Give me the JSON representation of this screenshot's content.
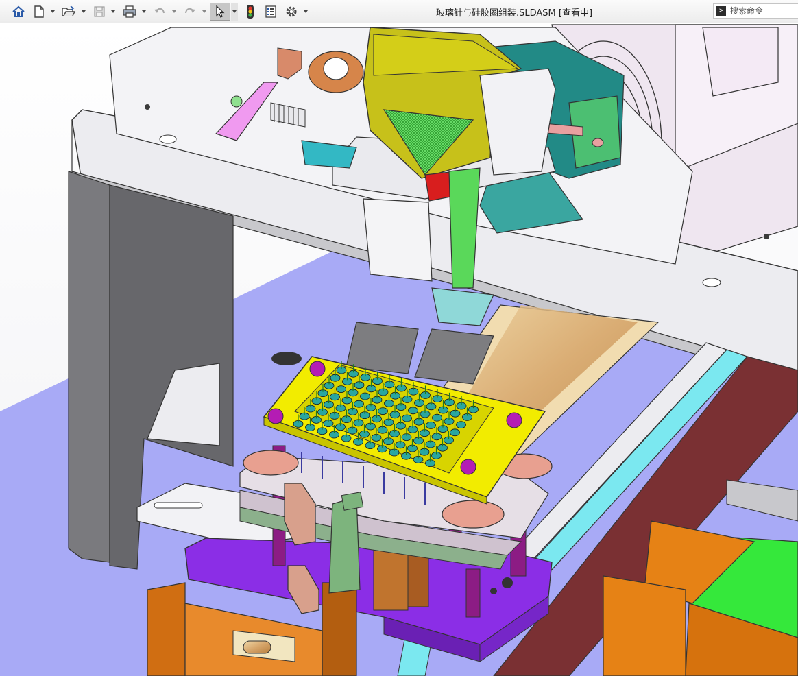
{
  "window": {
    "document_title": "玻璃针与硅胶圈组装.SLDASM [查看中]"
  },
  "toolbar": {
    "buttons": [
      {
        "name": "home-icon",
        "dropdown": false
      },
      {
        "name": "new-document-icon",
        "dropdown": true
      },
      {
        "name": "open-folder-icon",
        "dropdown": true
      },
      {
        "name": "save-icon",
        "dropdown": true
      },
      {
        "name": "print-icon",
        "dropdown": true
      },
      {
        "name": "undo-icon",
        "dropdown": true
      },
      {
        "name": "redo-icon",
        "dropdown": true
      },
      {
        "name": "select-pointer-icon",
        "dropdown": true
      },
      {
        "name": "rebuild-traffic-light-icon",
        "dropdown": false
      },
      {
        "name": "file-properties-icon",
        "dropdown": false
      },
      {
        "name": "options-gear-icon",
        "dropdown": true
      }
    ]
  },
  "search": {
    "placeholder": "搜索命令"
  },
  "viewport": {
    "content": "3D assembly model",
    "colors": {
      "background": "#ffffff",
      "floor": "#a7a9f5",
      "frame_white": "#ececf0",
      "frame_side": "#6a6a6e",
      "plate_yellow": "#f0e800",
      "block_purple": "#8a2ee0",
      "rail_cyan": "#6ee8f0",
      "belt_brown": "#7a3033",
      "green_part": "#34e83a",
      "orange_part": "#e07a10"
    }
  }
}
